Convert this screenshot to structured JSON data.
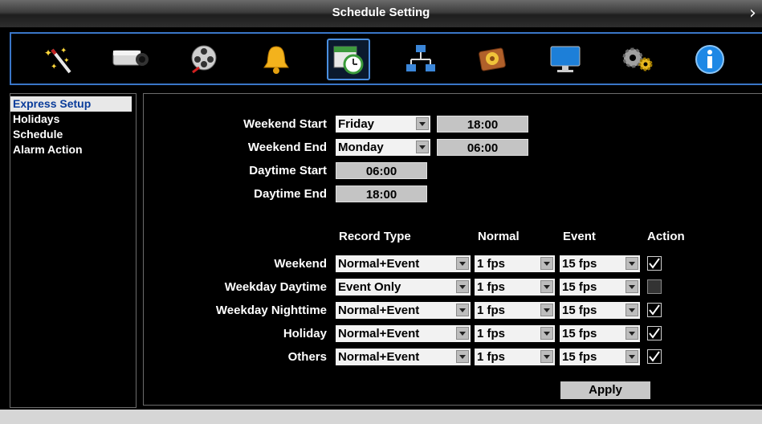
{
  "window": {
    "title": "Schedule Setting",
    "close_glyph": "›"
  },
  "toolbar": {
    "icons": [
      {
        "name": "wizard-wand-icon"
      },
      {
        "name": "camera-icon"
      },
      {
        "name": "film-reel-icon"
      },
      {
        "name": "alarm-bell-icon"
      },
      {
        "name": "schedule-clock-icon",
        "selected": true
      },
      {
        "name": "network-icon"
      },
      {
        "name": "hard-disk-icon"
      },
      {
        "name": "monitor-icon"
      },
      {
        "name": "system-gears-icon"
      },
      {
        "name": "info-icon"
      }
    ]
  },
  "sidebar": {
    "items": [
      {
        "label": "Express Setup",
        "active": true
      },
      {
        "label": "Holidays"
      },
      {
        "label": "Schedule"
      },
      {
        "label": "Alarm Action"
      }
    ]
  },
  "express": {
    "weekend_start": {
      "label": "Weekend Start",
      "day": "Friday",
      "time": "18:00"
    },
    "weekend_end": {
      "label": "Weekend End",
      "day": "Monday",
      "time": "06:00"
    },
    "daytime_start": {
      "label": "Daytime Start",
      "time": "06:00"
    },
    "daytime_end": {
      "label": "Daytime End",
      "time": "18:00"
    }
  },
  "record_table": {
    "headers": {
      "record_type": "Record Type",
      "normal": "Normal",
      "event": "Event",
      "action": "Action"
    },
    "rows": [
      {
        "label": "Weekend",
        "record_type": "Normal+Event",
        "normal": "1 fps",
        "event": "15 fps",
        "action": true
      },
      {
        "label": "Weekday Daytime",
        "record_type": "Event Only",
        "normal": "1 fps",
        "event": "15 fps",
        "action": false
      },
      {
        "label": "Weekday Nighttime",
        "record_type": "Normal+Event",
        "normal": "1 fps",
        "event": "15 fps",
        "action": true
      },
      {
        "label": "Holiday",
        "record_type": "Normal+Event",
        "normal": "1 fps",
        "event": "15 fps",
        "action": true
      },
      {
        "label": "Others",
        "record_type": "Normal+Event",
        "normal": "1 fps",
        "event": "15 fps",
        "action": true
      }
    ]
  },
  "buttons": {
    "apply": "Apply"
  }
}
